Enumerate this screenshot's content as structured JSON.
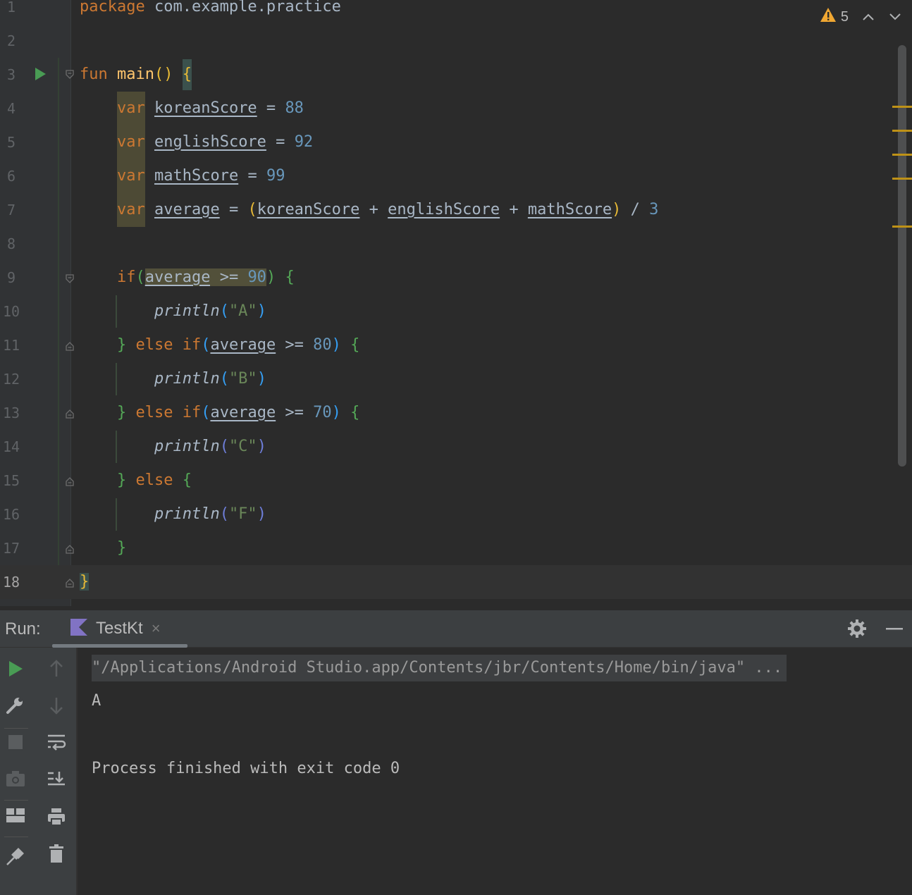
{
  "editor": {
    "line_numbers": [
      "1",
      "2",
      "3",
      "4",
      "5",
      "6",
      "7",
      "8",
      "9",
      "10",
      "11",
      "12",
      "13",
      "14",
      "15",
      "16",
      "17",
      "18"
    ],
    "inspection_warning_count": "5",
    "lines": [
      [
        [
          "kw",
          "package"
        ],
        [
          "pln",
          " com.example.practice"
        ]
      ],
      [],
      [
        [
          "kw",
          "fun"
        ],
        [
          "pln",
          " "
        ],
        [
          "fn",
          "main"
        ],
        [
          "b1",
          "()"
        ],
        [
          "pln",
          " "
        ],
        [
          "b1 hlb2",
          "{"
        ]
      ],
      [
        [
          "pln",
          "    "
        ],
        [
          "kw hlv",
          "var"
        ],
        [
          "pln",
          " "
        ],
        [
          "pln u",
          "koreanScore"
        ],
        [
          "pln",
          " = "
        ],
        [
          "num",
          "88"
        ]
      ],
      [
        [
          "pln",
          "    "
        ],
        [
          "kw hlv",
          "var"
        ],
        [
          "pln",
          " "
        ],
        [
          "pln u",
          "englishScore"
        ],
        [
          "pln",
          " = "
        ],
        [
          "num",
          "92"
        ]
      ],
      [
        [
          "pln",
          "    "
        ],
        [
          "kw hlv",
          "var"
        ],
        [
          "pln",
          " "
        ],
        [
          "pln u",
          "mathScore"
        ],
        [
          "pln",
          " = "
        ],
        [
          "num",
          "99"
        ]
      ],
      [
        [
          "pln",
          "    "
        ],
        [
          "kw hlv",
          "var"
        ],
        [
          "pln",
          " "
        ],
        [
          "pln u",
          "average"
        ],
        [
          "pln",
          " = "
        ],
        [
          "b1",
          "("
        ],
        [
          "pln u",
          "koreanScore"
        ],
        [
          "pln",
          " + "
        ],
        [
          "pln u",
          "englishScore"
        ],
        [
          "pln",
          " + "
        ],
        [
          "pln u",
          "mathScore"
        ],
        [
          "b1",
          ")"
        ],
        [
          "pln",
          " / "
        ],
        [
          "num",
          "3"
        ]
      ],
      [],
      [
        [
          "pln",
          "    "
        ],
        [
          "kw",
          "if"
        ],
        [
          "b2",
          "("
        ],
        [
          "pln u hl",
          "average"
        ],
        [
          "pln hl",
          " >= "
        ],
        [
          "num hl",
          "90"
        ],
        [
          "b2",
          ")"
        ],
        [
          "pln",
          " "
        ],
        [
          "b2",
          "{"
        ]
      ],
      [
        [
          "pln",
          "        "
        ],
        [
          "pln it",
          "println"
        ],
        [
          "b3",
          "("
        ],
        [
          "str",
          "\"A\""
        ],
        [
          "b3",
          ")"
        ]
      ],
      [
        [
          "pln",
          "    "
        ],
        [
          "b2",
          "}"
        ],
        [
          "pln",
          " "
        ],
        [
          "kw",
          "else"
        ],
        [
          "pln",
          " "
        ],
        [
          "kw",
          "if"
        ],
        [
          "b3",
          "("
        ],
        [
          "pln u",
          "average"
        ],
        [
          "pln",
          " >= "
        ],
        [
          "num",
          "80"
        ],
        [
          "b3",
          ")"
        ],
        [
          "pln",
          " "
        ],
        [
          "b2",
          "{"
        ]
      ],
      [
        [
          "pln",
          "        "
        ],
        [
          "pln it",
          "println"
        ],
        [
          "b3",
          "("
        ],
        [
          "str",
          "\"B\""
        ],
        [
          "b3",
          ")"
        ]
      ],
      [
        [
          "pln",
          "    "
        ],
        [
          "b2",
          "}"
        ],
        [
          "pln",
          " "
        ],
        [
          "kw",
          "else"
        ],
        [
          "pln",
          " "
        ],
        [
          "kw",
          "if"
        ],
        [
          "b3",
          "("
        ],
        [
          "pln u",
          "average"
        ],
        [
          "pln",
          " >= "
        ],
        [
          "num",
          "70"
        ],
        [
          "b3",
          ")"
        ],
        [
          "pln",
          " "
        ],
        [
          "b2",
          "{"
        ]
      ],
      [
        [
          "pln",
          "        "
        ],
        [
          "pln it",
          "println"
        ],
        [
          "b4",
          "("
        ],
        [
          "str",
          "\"C\""
        ],
        [
          "b4",
          ")"
        ]
      ],
      [
        [
          "pln",
          "    "
        ],
        [
          "b2",
          "}"
        ],
        [
          "pln",
          " "
        ],
        [
          "kw",
          "else"
        ],
        [
          "pln",
          " "
        ],
        [
          "b2",
          "{"
        ]
      ],
      [
        [
          "pln",
          "        "
        ],
        [
          "pln it",
          "println"
        ],
        [
          "b4",
          "("
        ],
        [
          "str",
          "\"F\""
        ],
        [
          "b4",
          ")"
        ]
      ],
      [
        [
          "pln",
          "    "
        ],
        [
          "b2",
          "}"
        ]
      ],
      [
        [
          "b1 hlb",
          "}"
        ]
      ]
    ]
  },
  "run_panel": {
    "label": "Run:",
    "tab_name": "TestKt",
    "tab_close": "×",
    "console": {
      "command": "\"/Applications/Android Studio.app/Contents/jbr/Contents/Home/bin/java\" ...",
      "output": "A",
      "exit_message": "Process finished with exit code 0"
    }
  },
  "icons": {
    "warning": "warning-triangle-icon",
    "prev": "chevron-up-icon",
    "next": "chevron-down-icon",
    "run": "play-icon",
    "rerun": "wrench-icon",
    "stop": "stop-icon",
    "dump": "camera-icon",
    "layout": "layout-icon",
    "pin": "pin-icon",
    "up": "arrow-up-icon",
    "down": "arrow-down-icon",
    "wrap": "soft-wrap-icon",
    "scroll_end": "scroll-to-end-icon",
    "print": "print-icon",
    "trash": "trash-icon",
    "settings": "gear-icon",
    "minimize": "minimize-icon",
    "kotlin": "kotlin-file-icon"
  },
  "colors": {
    "keyword": "#cc7832",
    "number": "#6897bb",
    "string": "#6a8759",
    "function": "#ffc66d",
    "text": "#a9b7c6",
    "run_green": "#499c54",
    "warning": "#f0a732"
  }
}
